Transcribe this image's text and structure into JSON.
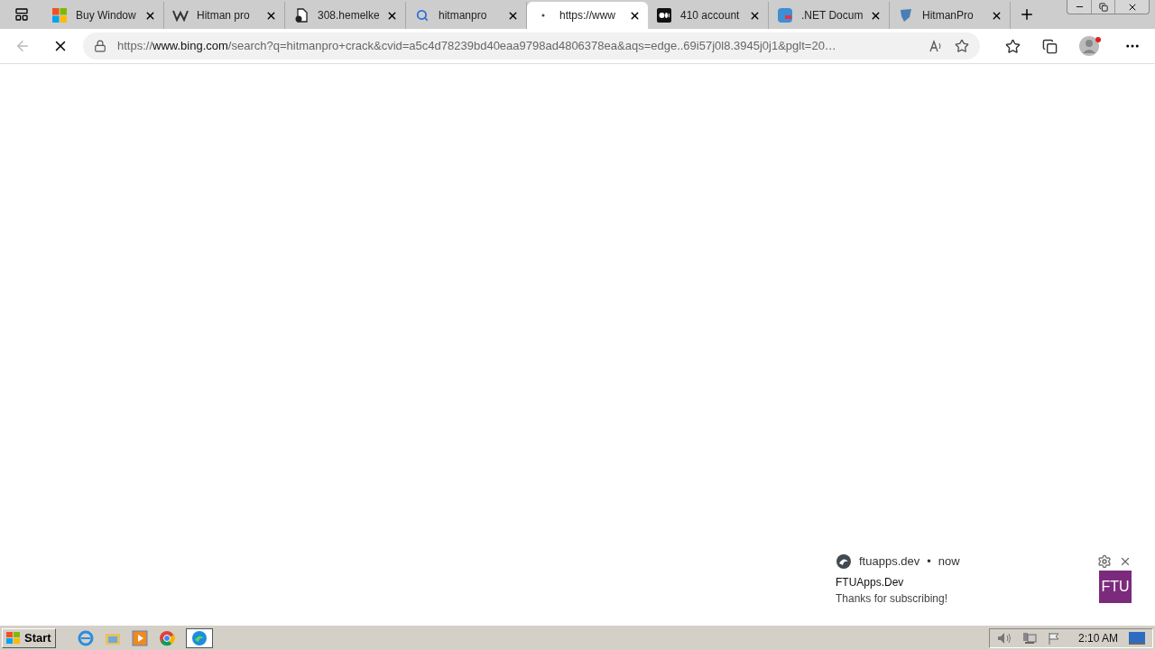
{
  "tabs": [
    {
      "kind": "windows",
      "label": "Buy Window",
      "selected": false
    },
    {
      "kind": "wiki",
      "label": "Hitman pro",
      "selected": false
    },
    {
      "kind": "document",
      "label": "308.hemelke",
      "selected": false
    },
    {
      "kind": "search",
      "label": "hitmanpro",
      "selected": false
    },
    {
      "kind": "loading",
      "label": "https://www",
      "selected": true
    },
    {
      "kind": "medium",
      "label": "410 account",
      "selected": false
    },
    {
      "kind": "net",
      "label": ".NET Docum",
      "selected": false
    },
    {
      "kind": "shield",
      "label": "HitmanPro",
      "selected": false
    }
  ],
  "address_bar": {
    "scheme": "https://",
    "host": "www.bing.com",
    "path": "/search?q=hitmanpro+crack&cvid=a5c4d78239bd40eaa9798ad4806378ea&aqs=edge..69i57j0l8.3945j0j1&pglt=20…",
    "loading": true
  },
  "notification": {
    "source": "ftuapps.dev",
    "separator": "•",
    "time": "now",
    "title": "FTUApps.Dev",
    "body": "Thanks for subscribing!",
    "badge": "FTU"
  },
  "taskbar": {
    "start": "Start",
    "clock": "2:10 AM"
  }
}
